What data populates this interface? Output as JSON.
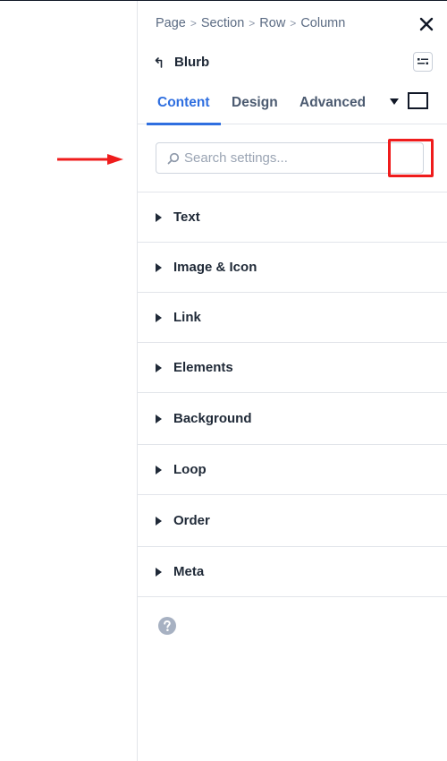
{
  "breadcrumb": [
    "Page",
    "Section",
    "Row",
    "Column"
  ],
  "module": {
    "title": "Blurb"
  },
  "tabs": {
    "content": "Content",
    "design": "Design",
    "advanced": "Advanced"
  },
  "search": {
    "placeholder": "Search settings...",
    "value": ""
  },
  "groups": [
    {
      "label": "Text"
    },
    {
      "label": "Image & Icon"
    },
    {
      "label": "Link"
    },
    {
      "label": "Elements"
    },
    {
      "label": "Background"
    },
    {
      "label": "Loop"
    },
    {
      "label": "Order"
    },
    {
      "label": "Meta"
    }
  ],
  "icons": {
    "close": "close-icon",
    "back": "back-arrow-icon",
    "menu": "panel-menu-icon",
    "caret": "caret-down-icon",
    "search": "search-icon",
    "group_caret": "caret-right-icon",
    "help": "help-icon"
  },
  "colors": {
    "accent": "#2f6fe0",
    "annotation": "#ef1c1c",
    "text": "#1f2937",
    "muted": "#5b6b83",
    "border": "#e2e5ea"
  }
}
